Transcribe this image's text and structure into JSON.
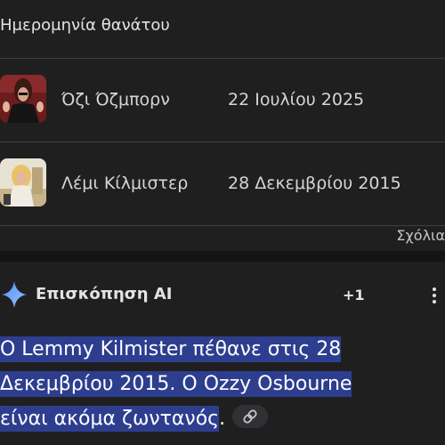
{
  "table": {
    "column_header": "Ημερομηνία θανάτου",
    "rows": [
      {
        "name": "Όζι Όζμπορν",
        "date": "22 Ιουλίου 2025",
        "thumb_icon": "ozzy-osbourne-photo"
      },
      {
        "name": "Λέμι Κίλμιστερ",
        "date": "28 Δεκεμβρίου 2015",
        "thumb_icon": "lemmy-kilmister-photo"
      }
    ],
    "comments_label": "Σχόλια"
  },
  "ai_overview": {
    "title": "Επισκόπηση AI",
    "count": "+1",
    "icon": "sparkle-icon",
    "lines": [
      "Ο Lemmy Kilmister πέθανε στις 28",
      "Δεκεμβρίου 2015. Ο Ozzy Osbourne",
      "είναι ακόμα ζωντανός"
    ],
    "trailing_period": ".",
    "accent_color": "#8ab4f8",
    "highlight_color": "#2d3e8f"
  }
}
